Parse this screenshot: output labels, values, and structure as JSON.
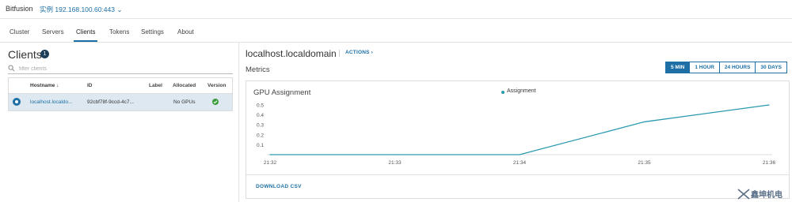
{
  "header": {
    "brand": "Bitfusion",
    "instance": "实例 192.168.100.60:443 ⌄"
  },
  "tabs": [
    {
      "label": "Cluster"
    },
    {
      "label": "Servers"
    },
    {
      "label": "Clients",
      "active": true
    },
    {
      "label": "Tokens"
    },
    {
      "label": "Settings"
    },
    {
      "label": "About"
    }
  ],
  "clients_panel": {
    "title": "Clients",
    "count": "1",
    "filter_placeholder": "filter clients",
    "columns": [
      "Hostname ↓",
      "ID",
      "Label",
      "Allocated",
      "Version"
    ],
    "rows": [
      {
        "hostname": "localhost.localdo...",
        "id": "92cbf78f-9ccd-4c7...",
        "label": "",
        "allocated": "No GPUs",
        "version_status": "ok"
      }
    ]
  },
  "detail": {
    "host_title": "localhost.localdomain",
    "actions_label": "ACTIONS ›",
    "metrics_label": "Metrics",
    "time_ranges": [
      "5 MIN",
      "1 HOUR",
      "24 HOURS",
      "30 DAYS"
    ],
    "active_range": "5 MIN",
    "download_label": "DOWNLOAD CSV"
  },
  "chart_data": {
    "type": "line",
    "title": "GPU Assignment",
    "series": [
      {
        "name": "Assignment",
        "color": "#2a9ab0",
        "x": [
          "21:32",
          "21:33",
          "21:34",
          "21:35",
          "21:36"
        ],
        "values": [
          0,
          0,
          0,
          0.33,
          0.5
        ]
      }
    ],
    "x_ticks": [
      "21:32",
      "21:33",
      "21:34",
      "21:35",
      "21:36"
    ],
    "y_ticks": [
      "0.1",
      "0.2",
      "0.3",
      "0.4",
      "0.5"
    ],
    "ylim": [
      0,
      0.5
    ],
    "legend_position": "top-center",
    "grid": "horizontal-baseline"
  },
  "watermark": {
    "text": "鑫坤机电"
  },
  "colors": {
    "accent": "#1d6fa5",
    "series": "#2a9ab0",
    "ok": "#3c9b3c"
  }
}
